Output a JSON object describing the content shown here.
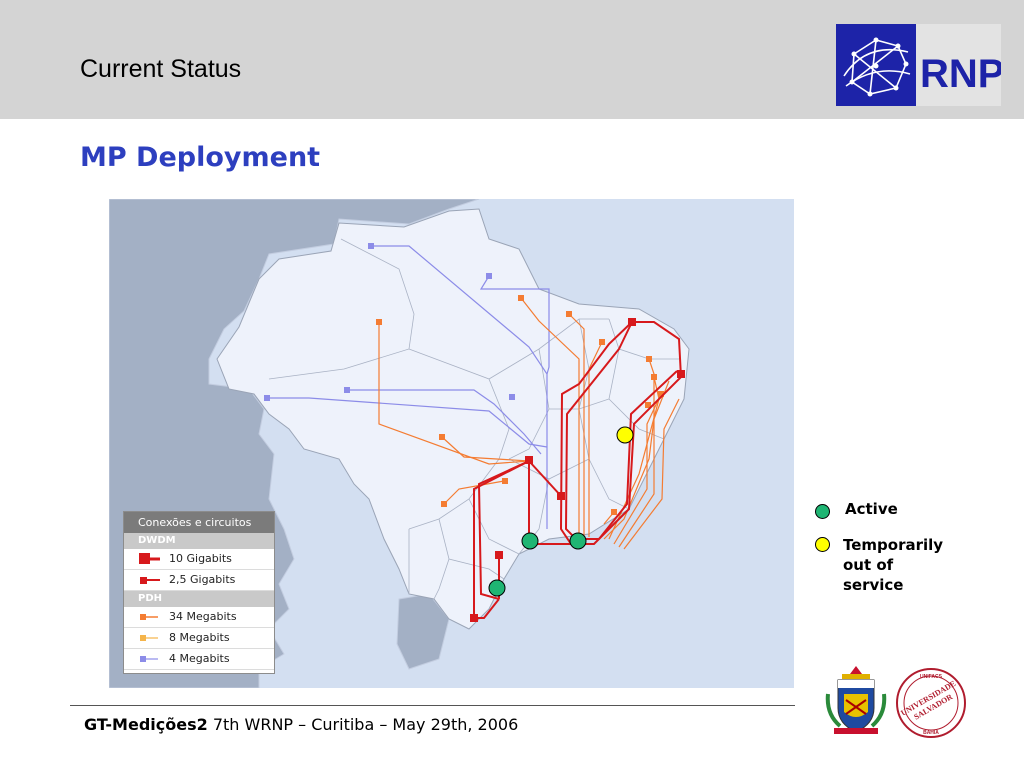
{
  "slide": {
    "title": "Current Status",
    "section_title": "MP Deployment"
  },
  "logo": {
    "text": "RNP",
    "bg_color": "#1d23a8"
  },
  "map_legend": {
    "title": "Conexões e circuitos",
    "group_dwdm": "DWDM",
    "dwdm_10": "10 Gigabits",
    "dwdm_25": "2,5 Gigabits",
    "group_pdh": "PDH",
    "pdh_34": "34 Megabits",
    "pdh_8": "8 Megabits",
    "pdh_4": "4 Megabits"
  },
  "status_legend": {
    "active": "Active",
    "temp_line1": "Temporarily",
    "temp_line2": "out of",
    "temp_line3": "service",
    "active_color": "#1fb573",
    "temp_color": "#ffff00"
  },
  "colors": {
    "dwdm": "#d7191c",
    "pdh34": "#f47c32",
    "pdh8": "#f5b44a",
    "pdh4": "#8c8ce8",
    "ocean": "#d3dff1",
    "brazil": "#eef2fb",
    "neighbors": "#a3b0c5"
  },
  "footer": {
    "bold": "GT-Medições2",
    "text": " 7th WRNP –  Curitiba – May 29th, 2006"
  },
  "seals": {
    "unifacs_top": "UNIFACS",
    "unifacs_line1": "UNIVERSIDADE",
    "unifacs_line2": "SALVADOR",
    "unifacs_bottom": "BAHIA"
  }
}
